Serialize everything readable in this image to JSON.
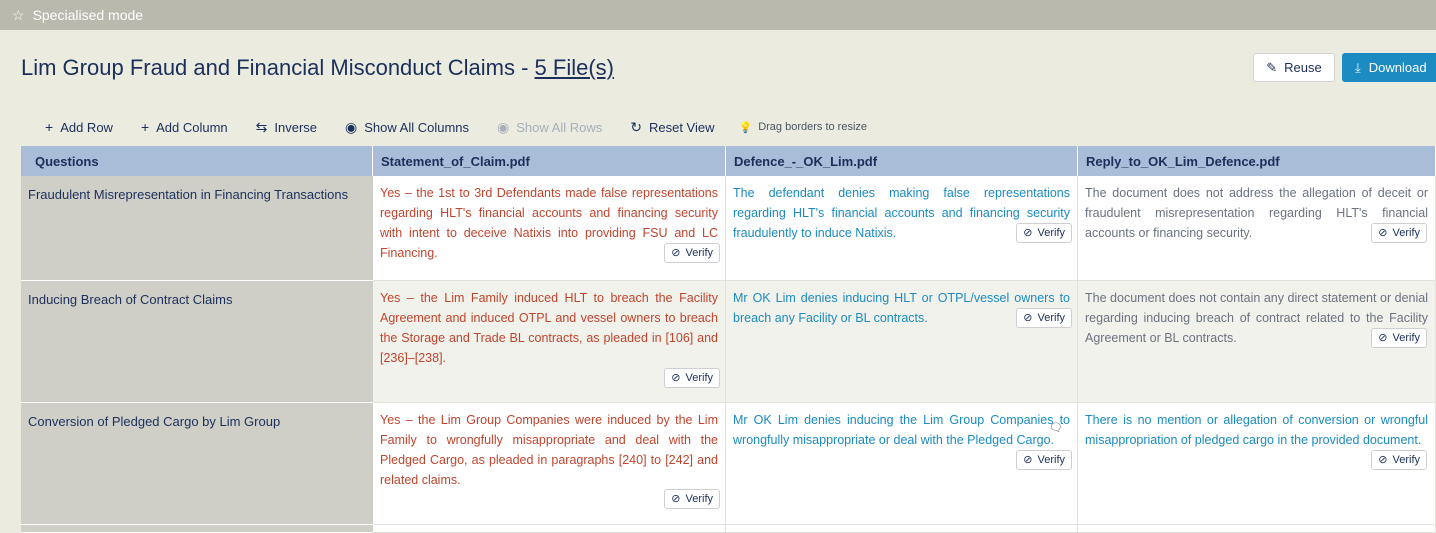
{
  "mode": {
    "label": "Specialised mode",
    "icon": "star-icon"
  },
  "title": {
    "text": "Lim Group Fraud and Financial Misconduct Claims - ",
    "files": "5 File(s)"
  },
  "actions": {
    "reuse": "Reuse",
    "download": "Download"
  },
  "toolbar": {
    "add_row": "Add Row",
    "add_column": "Add Column",
    "inverse": "Inverse",
    "show_all_columns": "Show All Columns",
    "show_all_rows": "Show All Rows",
    "reset_view": "Reset View",
    "hint": "Drag borders to resize"
  },
  "table": {
    "headers": [
      "Questions",
      "Statement_of_Claim.pdf",
      "Defence_-_OK_Lim.pdf",
      "Reply_to_OK_Lim_Defence.pdf"
    ],
    "verify_label": "Verify",
    "rows": [
      {
        "question": "Fraudulent Misrepresentation in Financing Transactions",
        "answers": [
          "Yes – the 1st to 3rd Defendants made false representations regarding HLT's financial accounts and financing security with intent to deceive Natixis into providing FSU and LC Financing.",
          "The defendant denies making false representations regarding HLT's financial accounts and financing security fraudulently to induce Natixis.",
          "The document does not address the allegation of deceit or fraudulent misrepresentation regarding HLT's financial accounts or financing security."
        ]
      },
      {
        "question": "Inducing Breach of Contract Claims",
        "answers": [
          "Yes – the Lim Family induced HLT to breach the Facility Agreement and induced OTPL and vessel owners to breach the Storage and Trade BL contracts, as pleaded in [106] and [236]–[238].",
          "Mr OK Lim denies inducing HLT or OTPL/vessel owners to breach any Facility or BL contracts.",
          "The document does not contain any direct statement or denial regarding inducing breach of contract related to the Facility Agreement or BL contracts."
        ]
      },
      {
        "question": "Conversion of Pledged Cargo by Lim Group",
        "answers": [
          "Yes – the Lim Group Companies were induced by the Lim Family to wrongfully misappropriate and deal with the Pledged Cargo, as pleaded in paragraphs [240] to [242] and related claims.",
          "Mr OK Lim denies inducing the Lim Group Companies to wrongfully misappropriate or deal with the Pledged Cargo.",
          "There is no mention or allegation of conversion or wrongful misappropriation of pledged cargo in the provided document."
        ]
      }
    ]
  },
  "colors": {
    "accent": "#1b8bc1",
    "claim_text": "#c0452d",
    "defence_text": "#1b8bc1",
    "neutral_text": "#6b7280",
    "header_bg": "#a9bcd8"
  }
}
